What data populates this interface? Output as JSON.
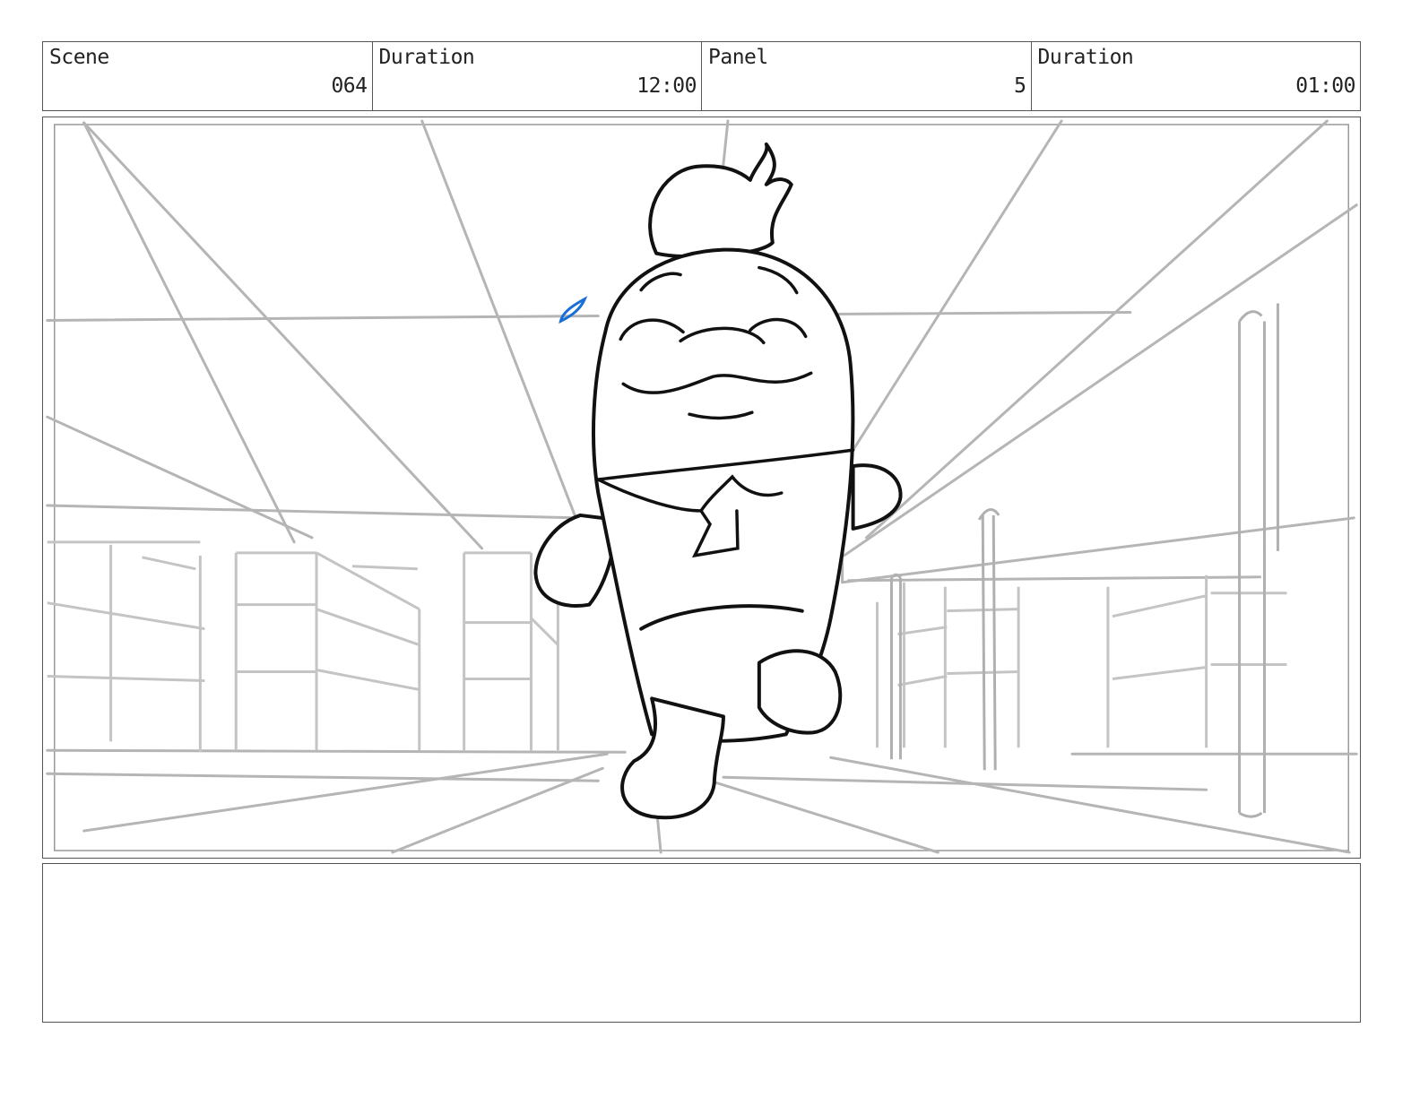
{
  "header": {
    "fields": [
      {
        "label": "Scene",
        "value": "064"
      },
      {
        "label": "Duration",
        "value": "12:00"
      },
      {
        "label": "Panel",
        "value": "5"
      },
      {
        "label": "Duration",
        "value": "01:00"
      }
    ]
  },
  "panel": {
    "drawing_description_icon": "storyboard-sketch-icon",
    "colors": {
      "background_lines": "#b5b5b5",
      "character_ink": "#111111",
      "sweat_drop": "#1a6fd6"
    }
  },
  "notes": {
    "text": ""
  }
}
